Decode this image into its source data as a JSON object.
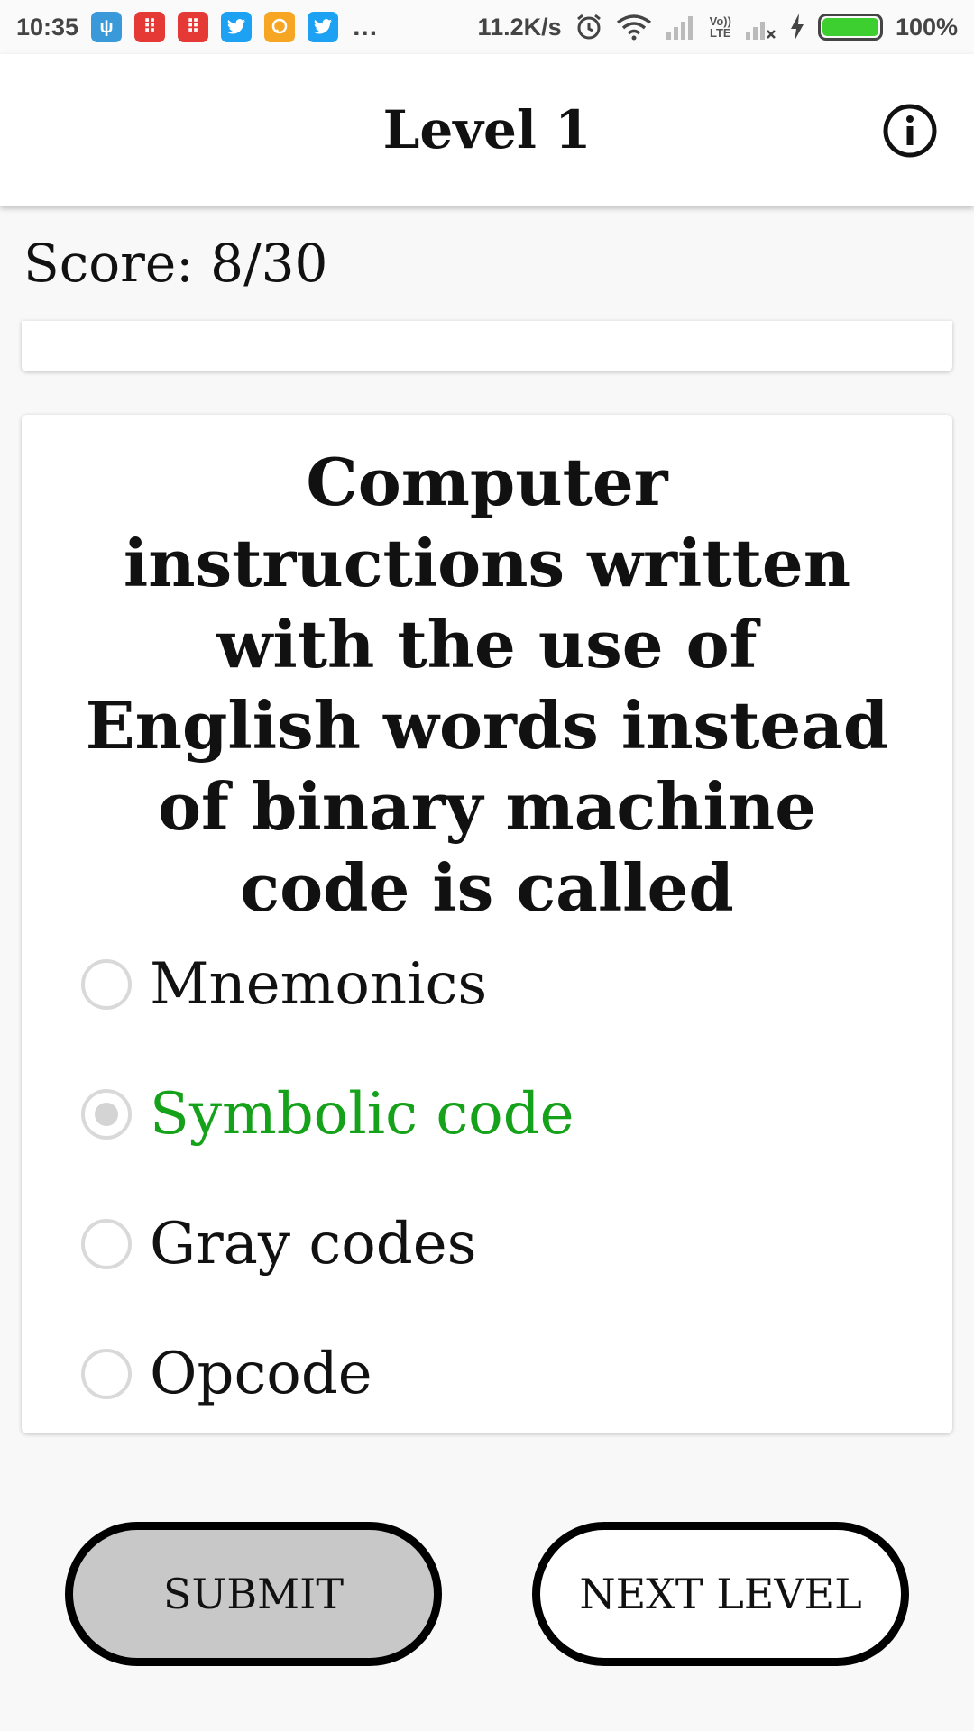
{
  "status_bar": {
    "time": "10:35",
    "net_speed": "11.2K/s",
    "volte_top": "Vo))",
    "volte_bottom": "LTE",
    "battery_percent": "100%",
    "overflow": "..."
  },
  "app_bar": {
    "title": "Level 1"
  },
  "score": {
    "text": "Score: 8/30"
  },
  "question": {
    "text": "Computer instructions written with the use of English words instead of binary machine code is called",
    "options": [
      {
        "label": "Mnemonics",
        "selected": false,
        "correct": false
      },
      {
        "label": "Symbolic code",
        "selected": true,
        "correct": true
      },
      {
        "label": "Gray codes",
        "selected": false,
        "correct": false
      },
      {
        "label": "Opcode",
        "selected": false,
        "correct": false
      }
    ]
  },
  "buttons": {
    "submit": "SUBMIT",
    "next_level": "NEXT LEVEL"
  },
  "colors": {
    "correct_answer": "#15a21a",
    "submit_bg": "#c8c8c8",
    "battery": "#3ccf2f"
  }
}
